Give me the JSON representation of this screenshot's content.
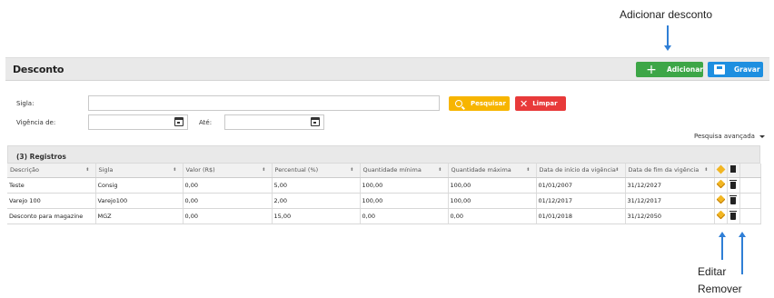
{
  "annotations": {
    "add_discount": "Adicionar desconto",
    "edit": "Editar",
    "remove": "Remover"
  },
  "header": {
    "title": "Desconto",
    "add_label": "Adicionar",
    "save_label": "Gravar"
  },
  "form": {
    "sigla_label": "Sigla:",
    "sigla_value": "",
    "vigencia_label": "Vigência de:",
    "vigencia_value": "",
    "ate_label": "Até:",
    "ate_value": "",
    "search_label": "Pesquisar",
    "clear_label": "Limpar",
    "advanced_label": "Pesquisa avançada"
  },
  "grid": {
    "records_label": "(3) Registros",
    "columns": [
      "Descrição",
      "Sigla",
      "Valor (R$)",
      "Percentual (%)",
      "Quantidade mínima",
      "Quantidade máxima",
      "Data de início da vigência",
      "Data de fim da vigência"
    ],
    "rows": [
      [
        "Teste",
        "Consig",
        "0,00",
        "5,00",
        "100,00",
        "100,00",
        "01/01/2007",
        "31/12/2027"
      ],
      [
        "Varejo 100",
        "Varejo100",
        "0,00",
        "2,00",
        "100,00",
        "100,00",
        "01/12/2017",
        "31/12/2017"
      ],
      [
        "Desconto para magazine",
        "MGZ",
        "0,00",
        "15,00",
        "0,00",
        "0,00",
        "01/01/2018",
        "31/12/2050"
      ]
    ]
  },
  "colors": {
    "add": "#3da647",
    "save": "#1e8fe0",
    "search": "#f7b500",
    "clear": "#e83a3a",
    "arrow": "#2f7fd6"
  }
}
